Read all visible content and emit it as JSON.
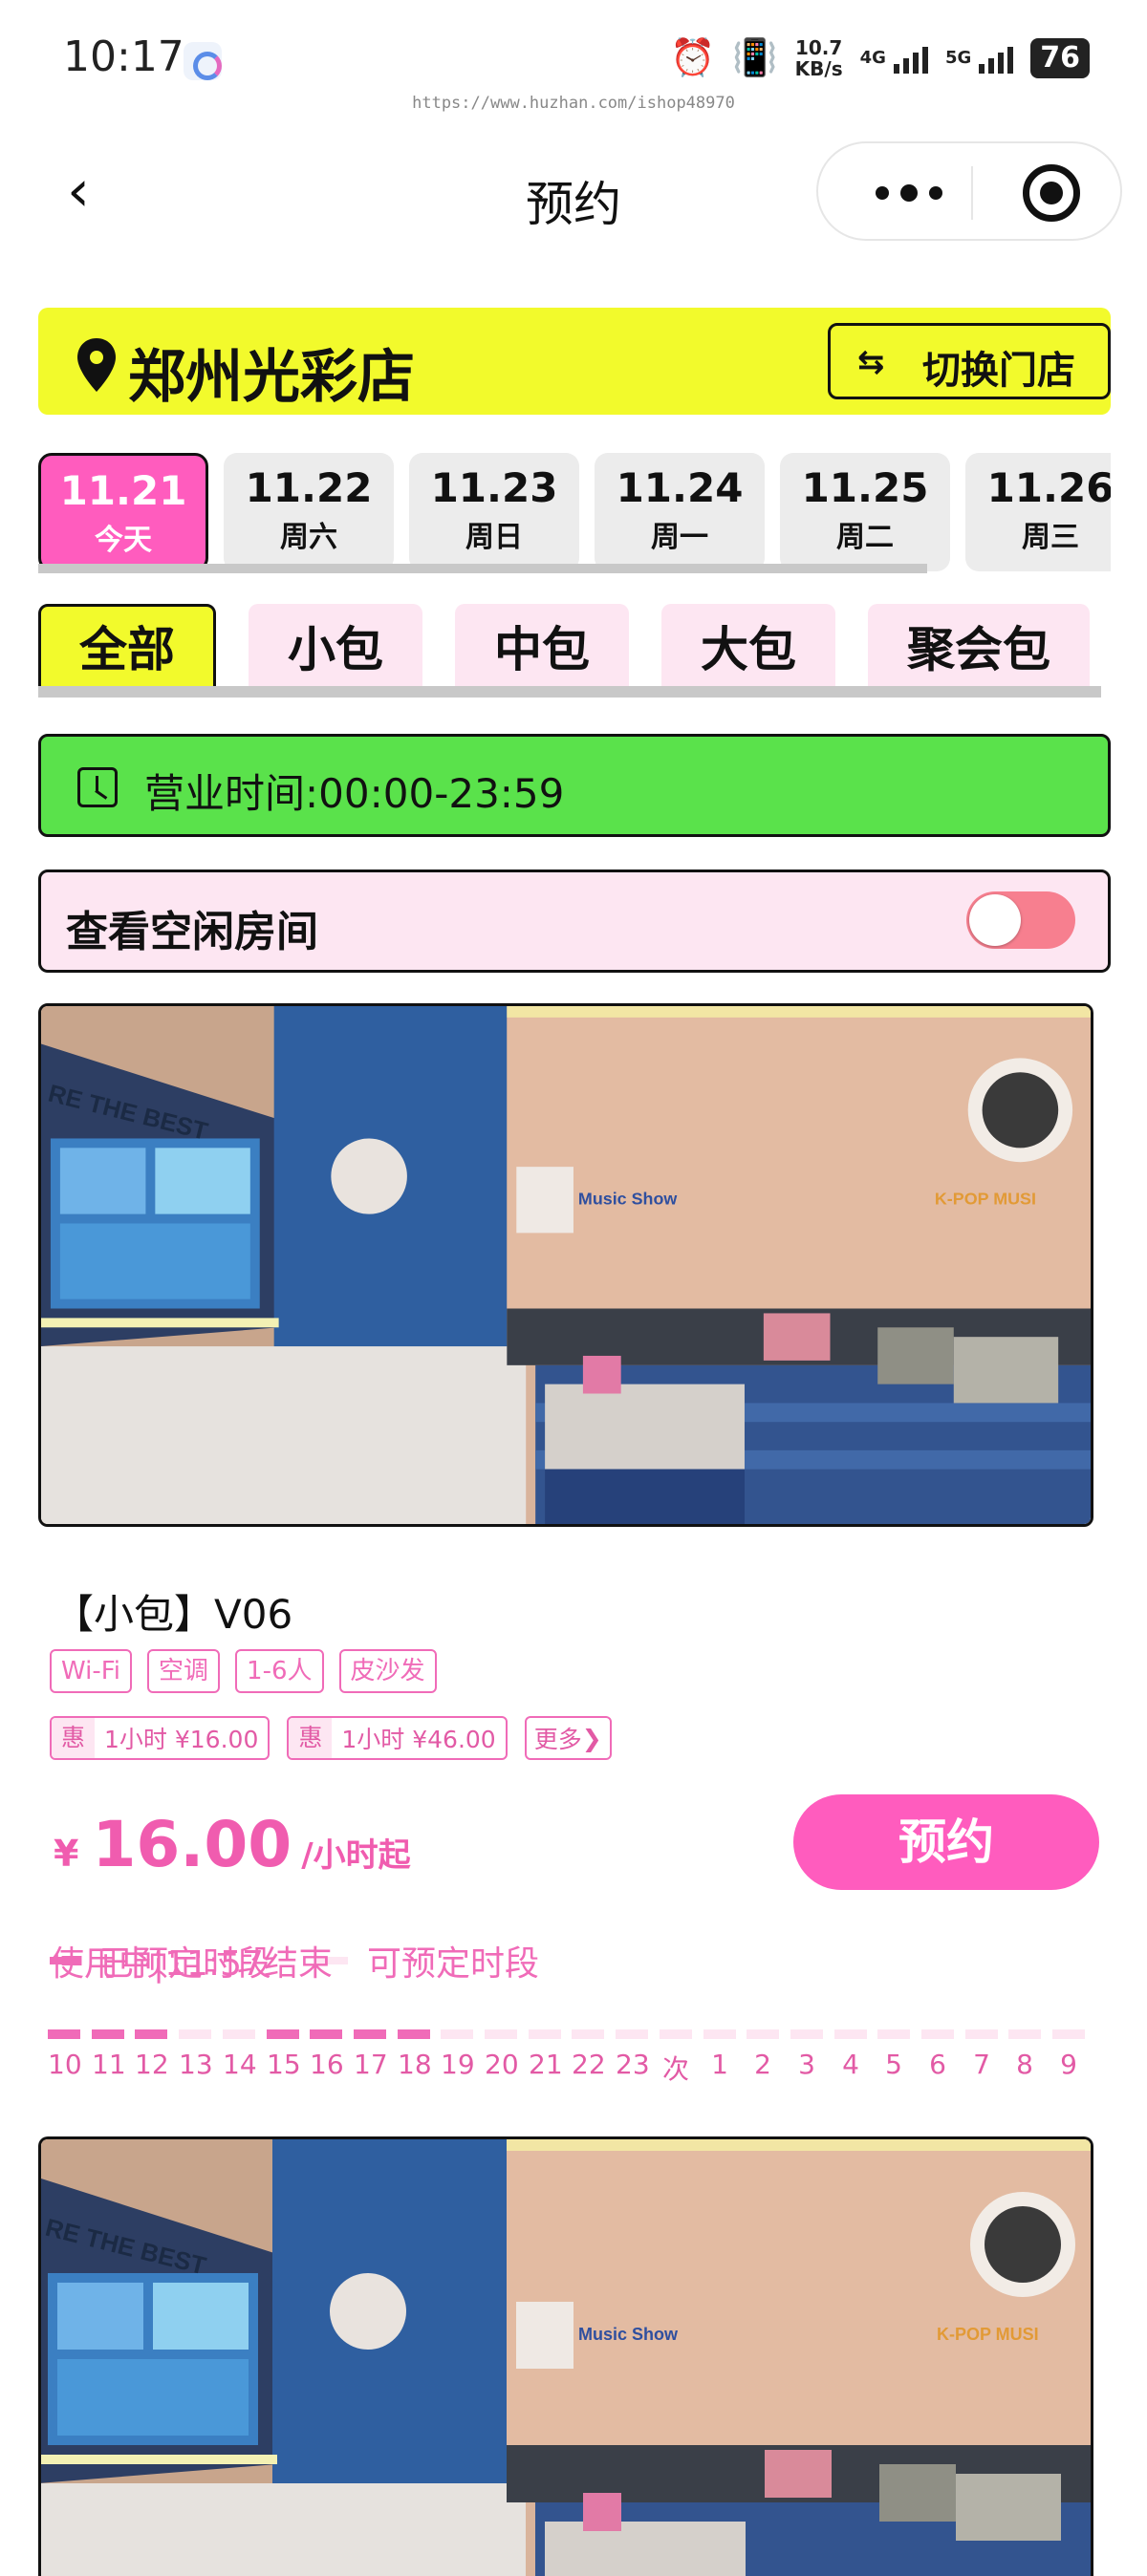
{
  "status_bar": {
    "time": "10:17",
    "speed_value": "10.7",
    "speed_unit": "KB/s",
    "net1": "4G",
    "net2": "5G",
    "battery": "76"
  },
  "watermark": "https://www.huzhan.com/ishop48970",
  "nav": {
    "title": "预约"
  },
  "store": {
    "name": "郑州光彩店",
    "switch_label": "切换门店",
    "switch_icon": "⇆"
  },
  "dates": [
    {
      "date": "11.21",
      "weekday": "今天",
      "active": true
    },
    {
      "date": "11.22",
      "weekday": "周六"
    },
    {
      "date": "11.23",
      "weekday": "周日"
    },
    {
      "date": "11.24",
      "weekday": "周一"
    },
    {
      "date": "11.25",
      "weekday": "周二"
    },
    {
      "date": "11.26",
      "weekday": "周三"
    }
  ],
  "tabs": [
    {
      "label": "全部",
      "active": true
    },
    {
      "label": "小包"
    },
    {
      "label": "中包"
    },
    {
      "label": "大包"
    },
    {
      "label": "聚会包"
    }
  ],
  "hours": {
    "label": "营业时间:00:00-23:59"
  },
  "free_rooms": {
    "label": "查看空闲房间",
    "toggle_on": false
  },
  "room": {
    "name": "【小包】V06",
    "tags": [
      "Wi-Fi",
      "空调",
      "1-6人",
      "皮沙发"
    ],
    "promos": [
      {
        "badge": "惠",
        "text": "1小时 ¥16.00"
      },
      {
        "badge": "惠",
        "text": "1小时 ¥46.00"
      }
    ],
    "more_label": "更多",
    "price_currency": "¥",
    "price": "16.00",
    "price_unit": "/小时起",
    "book_label": "预约",
    "photo_sign_1": "RE THE BEST",
    "photo_sign_2": "Music Show",
    "photo_sign_3": "K-POP MUSI"
  },
  "legend": {
    "booked_label": "已预定时段",
    "available_label": "可预定时段",
    "status": "使用中|11:57结束"
  },
  "timeline": [
    {
      "hour": "10",
      "booked": true
    },
    {
      "hour": "11",
      "booked": true
    },
    {
      "hour": "12",
      "booked": true
    },
    {
      "hour": "13",
      "booked": false
    },
    {
      "hour": "14",
      "booked": false
    },
    {
      "hour": "15",
      "booked": true
    },
    {
      "hour": "16",
      "booked": true
    },
    {
      "hour": "17",
      "booked": true
    },
    {
      "hour": "18",
      "booked": true
    },
    {
      "hour": "19",
      "booked": false
    },
    {
      "hour": "20",
      "booked": false
    },
    {
      "hour": "21",
      "booked": false
    },
    {
      "hour": "22",
      "booked": false
    },
    {
      "hour": "23",
      "booked": false
    },
    {
      "hour": "次",
      "booked": false
    },
    {
      "hour": "1",
      "booked": false
    },
    {
      "hour": "2",
      "booked": false
    },
    {
      "hour": "3",
      "booked": false
    },
    {
      "hour": "4",
      "booked": false
    },
    {
      "hour": "5",
      "booked": false
    },
    {
      "hour": "6",
      "booked": false
    },
    {
      "hour": "7",
      "booked": false
    },
    {
      "hour": "8",
      "booked": false
    },
    {
      "hour": "9",
      "booked": false
    }
  ],
  "colors": {
    "accent_pink": "#ff5cbe",
    "accent_yellow": "#f2fa2c",
    "hours_green": "#5ae24b",
    "light_pink": "#fde6f2",
    "text_pink": "#f06bb8"
  }
}
